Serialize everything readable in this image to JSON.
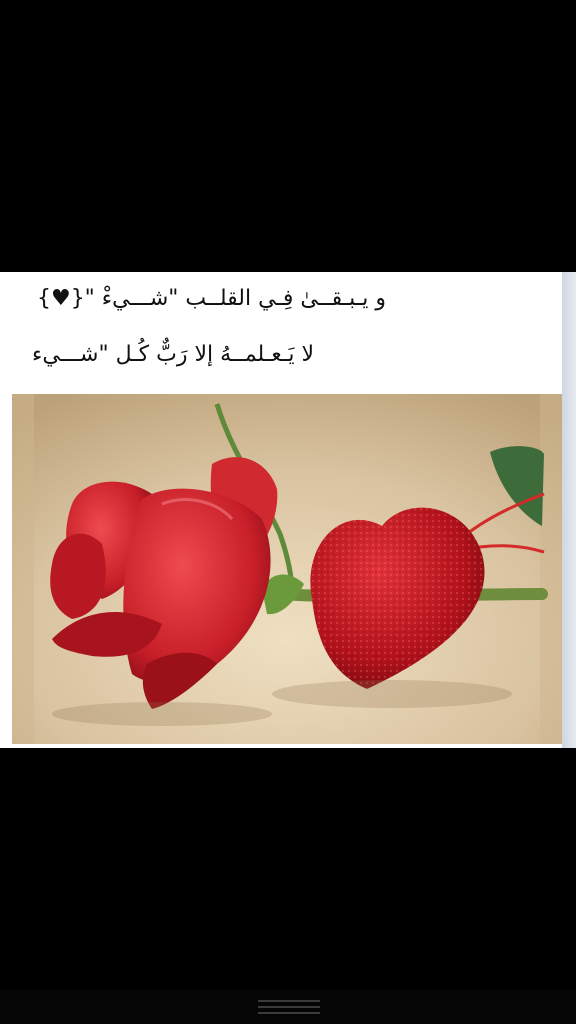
{
  "post": {
    "caption_line_1": "و يـبـقــىٰ فِـي القلــب \"شـــيءْ \"{♥}",
    "caption_line_2": "لا يَـعـلمــهُ إلا رَبٌّ كُـل \"شـــيء"
  },
  "photo": {
    "subject": "red rose with glitter heart",
    "colors": {
      "background": "#d9c3a0",
      "rose": "#c8202a",
      "heart": "#b8121c",
      "stem": "#5f8a3a"
    }
  },
  "bottom_bar": {
    "icon": "drag-handle-icon"
  }
}
